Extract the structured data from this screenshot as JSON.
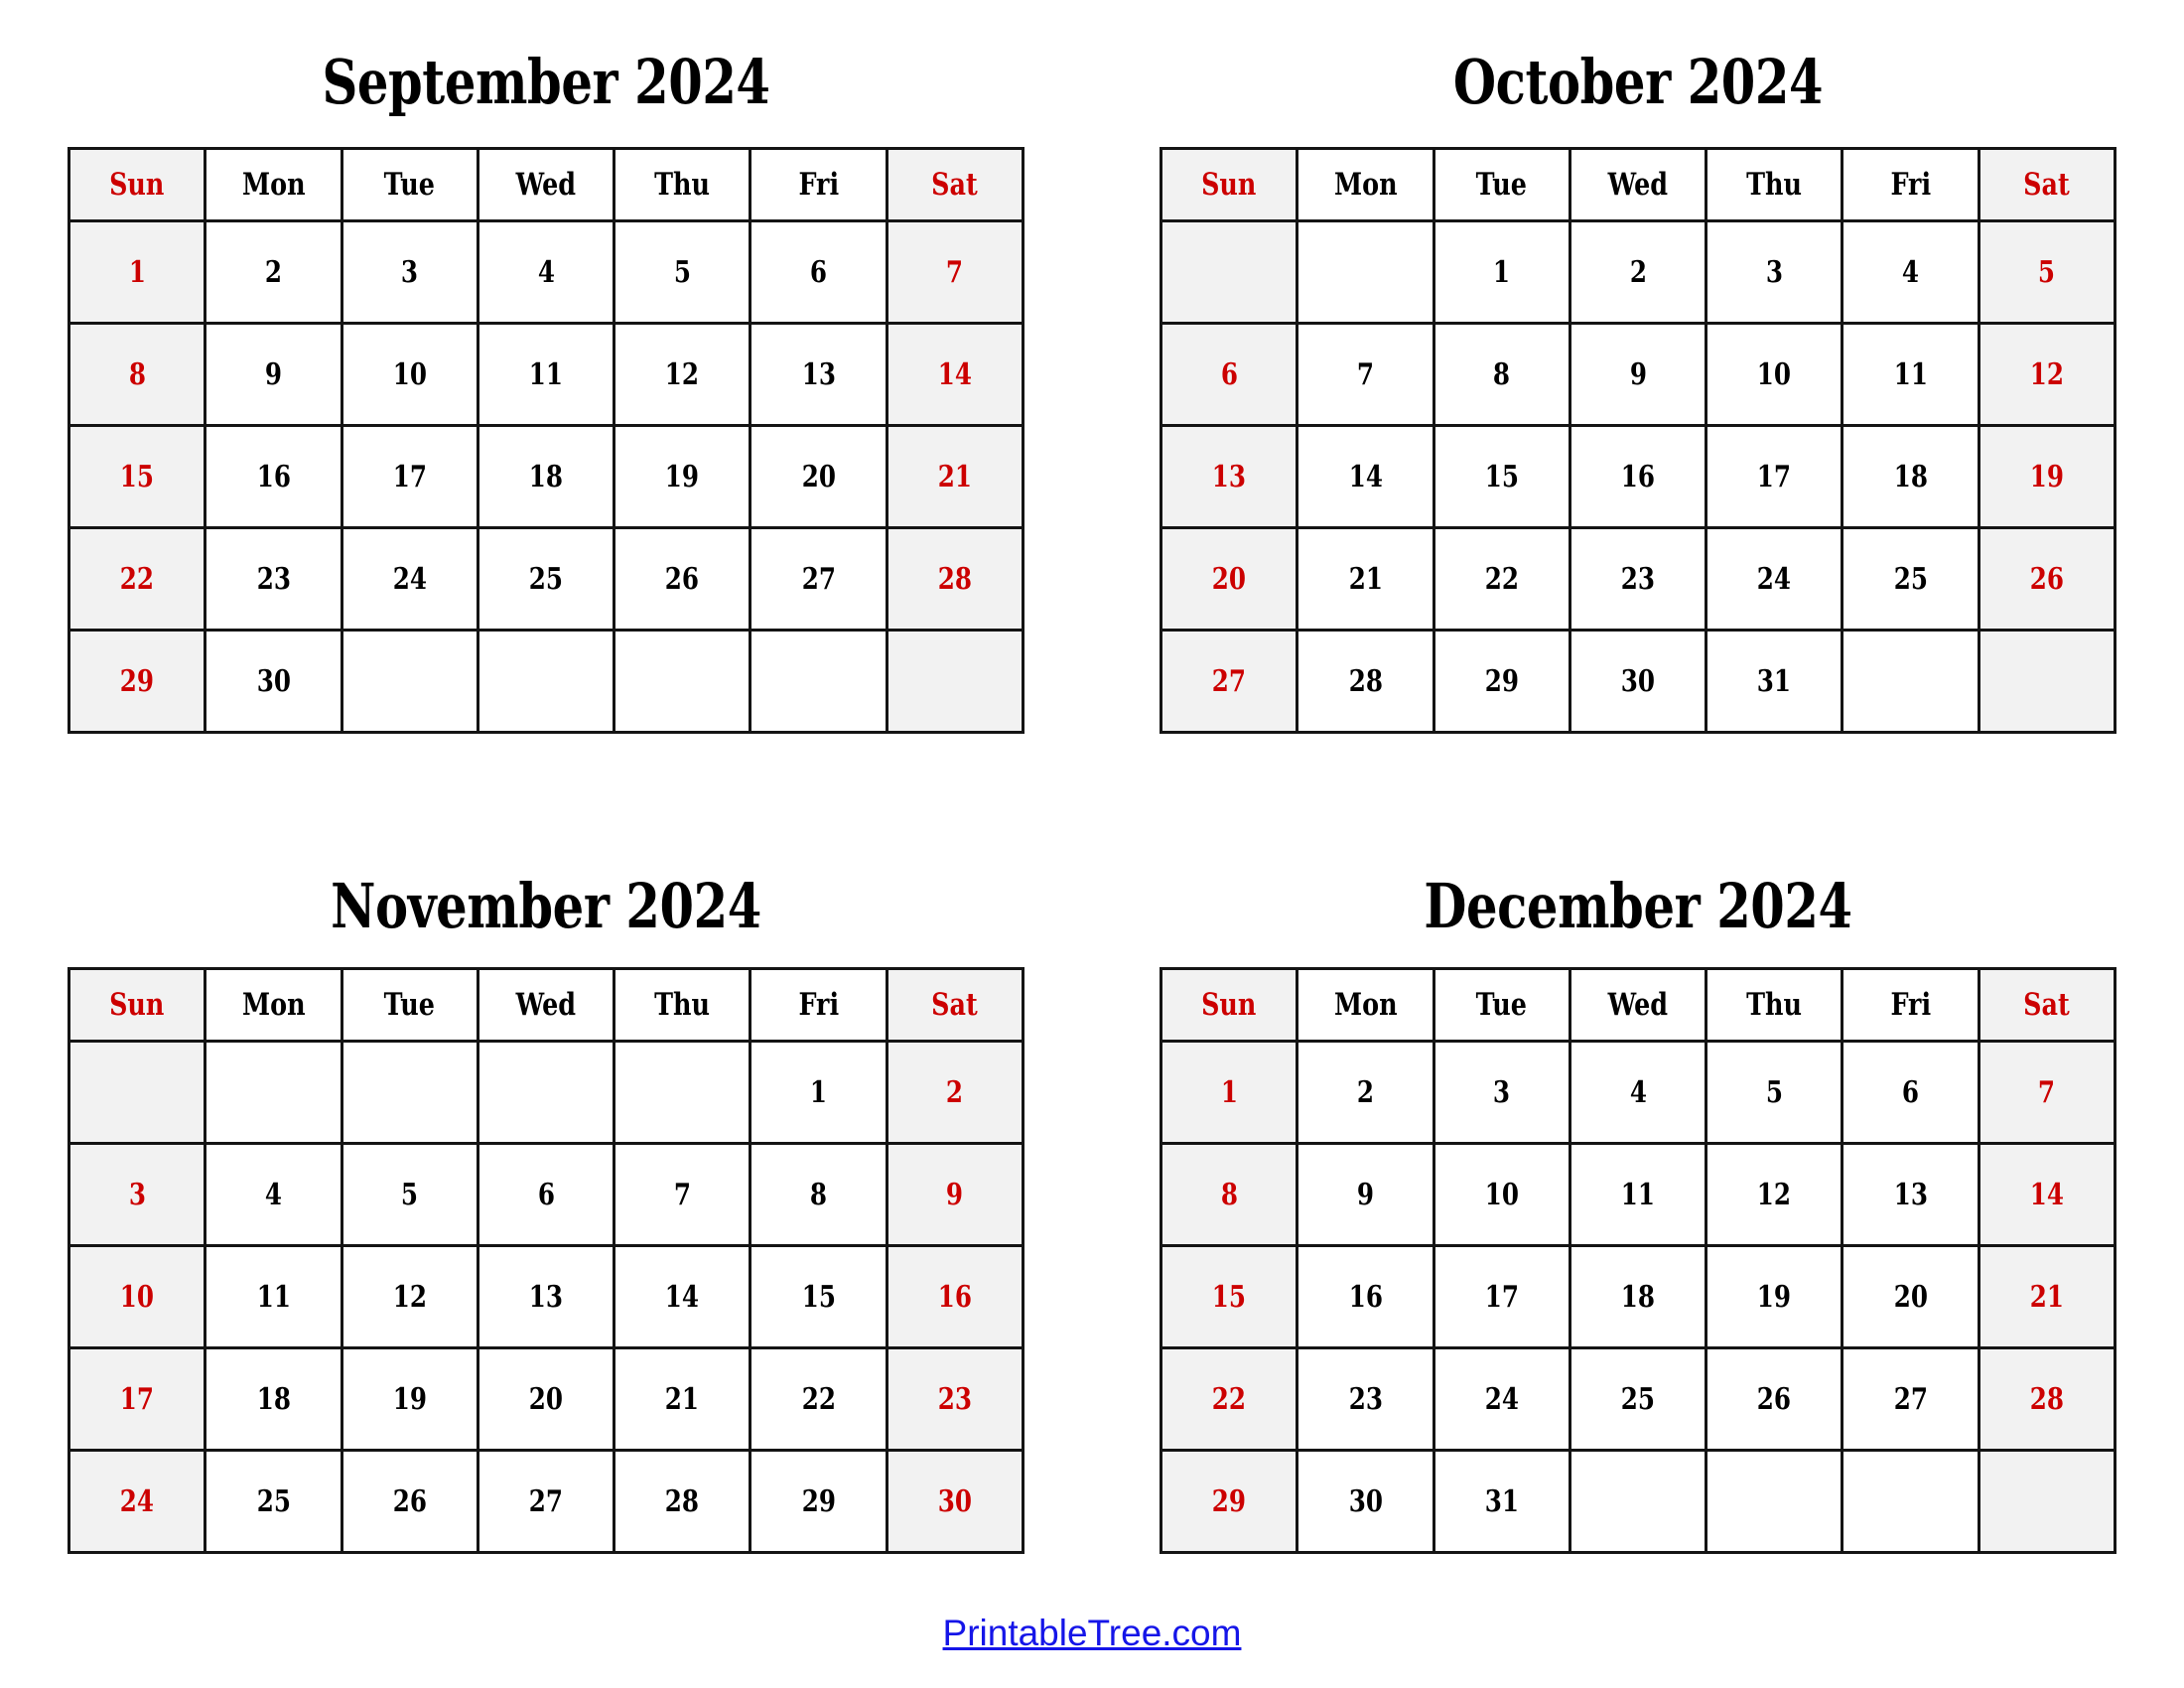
{
  "page": {
    "year": "2024",
    "weekend_color": "#cc0000",
    "weekend_bg": "#f2f2f2",
    "weekday_color": "#000000",
    "border_color": "#141414",
    "link_color": "#1515e8"
  },
  "weekday_headers": [
    "Sun",
    "Mon",
    "Tue",
    "Wed",
    "Thu",
    "Fri",
    "Sat"
  ],
  "months": [
    {
      "key": "sep",
      "title": "September 2024",
      "weeks": [
        [
          "1",
          "2",
          "3",
          "4",
          "5",
          "6",
          "7"
        ],
        [
          "8",
          "9",
          "10",
          "11",
          "12",
          "13",
          "14"
        ],
        [
          "15",
          "16",
          "17",
          "18",
          "19",
          "20",
          "21"
        ],
        [
          "22",
          "23",
          "24",
          "25",
          "26",
          "27",
          "28"
        ],
        [
          "29",
          "30",
          "",
          "",
          "",
          "",
          ""
        ]
      ]
    },
    {
      "key": "oct",
      "title": "October 2024",
      "weeks": [
        [
          "",
          "",
          "1",
          "2",
          "3",
          "4",
          "5"
        ],
        [
          "6",
          "7",
          "8",
          "9",
          "10",
          "11",
          "12"
        ],
        [
          "13",
          "14",
          "15",
          "16",
          "17",
          "18",
          "19"
        ],
        [
          "20",
          "21",
          "22",
          "23",
          "24",
          "25",
          "26"
        ],
        [
          "27",
          "28",
          "29",
          "30",
          "31",
          "",
          ""
        ]
      ]
    },
    {
      "key": "nov",
      "title": "November 2024",
      "weeks": [
        [
          "",
          "",
          "",
          "",
          "",
          "1",
          "2"
        ],
        [
          "3",
          "4",
          "5",
          "6",
          "7",
          "8",
          "9"
        ],
        [
          "10",
          "11",
          "12",
          "13",
          "14",
          "15",
          "16"
        ],
        [
          "17",
          "18",
          "19",
          "20",
          "21",
          "22",
          "23"
        ],
        [
          "24",
          "25",
          "26",
          "27",
          "28",
          "29",
          "30"
        ]
      ]
    },
    {
      "key": "dec",
      "title": "December 2024",
      "weeks": [
        [
          "1",
          "2",
          "3",
          "4",
          "5",
          "6",
          "7"
        ],
        [
          "8",
          "9",
          "10",
          "11",
          "12",
          "13",
          "14"
        ],
        [
          "15",
          "16",
          "17",
          "18",
          "19",
          "20",
          "21"
        ],
        [
          "22",
          "23",
          "24",
          "25",
          "26",
          "27",
          "28"
        ],
        [
          "29",
          "30",
          "31",
          "",
          "",
          "",
          ""
        ]
      ]
    }
  ],
  "footer": {
    "link_label": "PrintableTree.com"
  }
}
